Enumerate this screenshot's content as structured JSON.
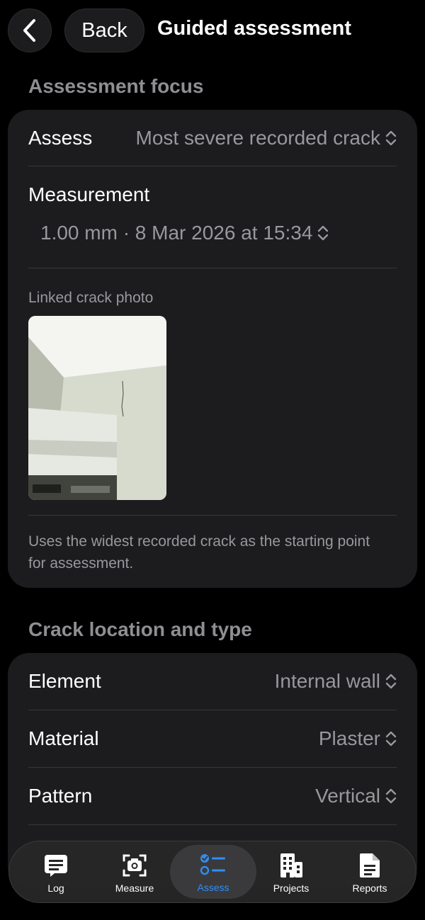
{
  "nav": {
    "back_label": "Back",
    "title": "Guided assessment"
  },
  "focus": {
    "header": "Assessment focus",
    "assess_label": "Assess",
    "assess_value": "Most severe recorded crack",
    "measurement_label": "Measurement",
    "measurement_value": "1.00 mm · 8 Mar 2026 at 15:34",
    "photo_caption": "Linked crack photo",
    "footnote": "Uses the widest recorded crack as the starting point for assessment."
  },
  "location": {
    "header": "Crack location and type",
    "rows": [
      {
        "label": "Element",
        "value": "Internal wall"
      },
      {
        "label": "Material",
        "value": "Plaster"
      },
      {
        "label": "Pattern",
        "value": "Vertical"
      }
    ]
  },
  "tabs": [
    {
      "label": "Log",
      "icon": "log-icon"
    },
    {
      "label": "Measure",
      "icon": "camera-icon"
    },
    {
      "label": "Assess",
      "icon": "checklist-icon"
    },
    {
      "label": "Projects",
      "icon": "building-icon"
    },
    {
      "label": "Reports",
      "icon": "document-icon"
    }
  ],
  "colors": {
    "background": "#000000",
    "card": "#1c1c1e",
    "accent": "#2f8ef5",
    "secondary_text": "#98989d"
  }
}
